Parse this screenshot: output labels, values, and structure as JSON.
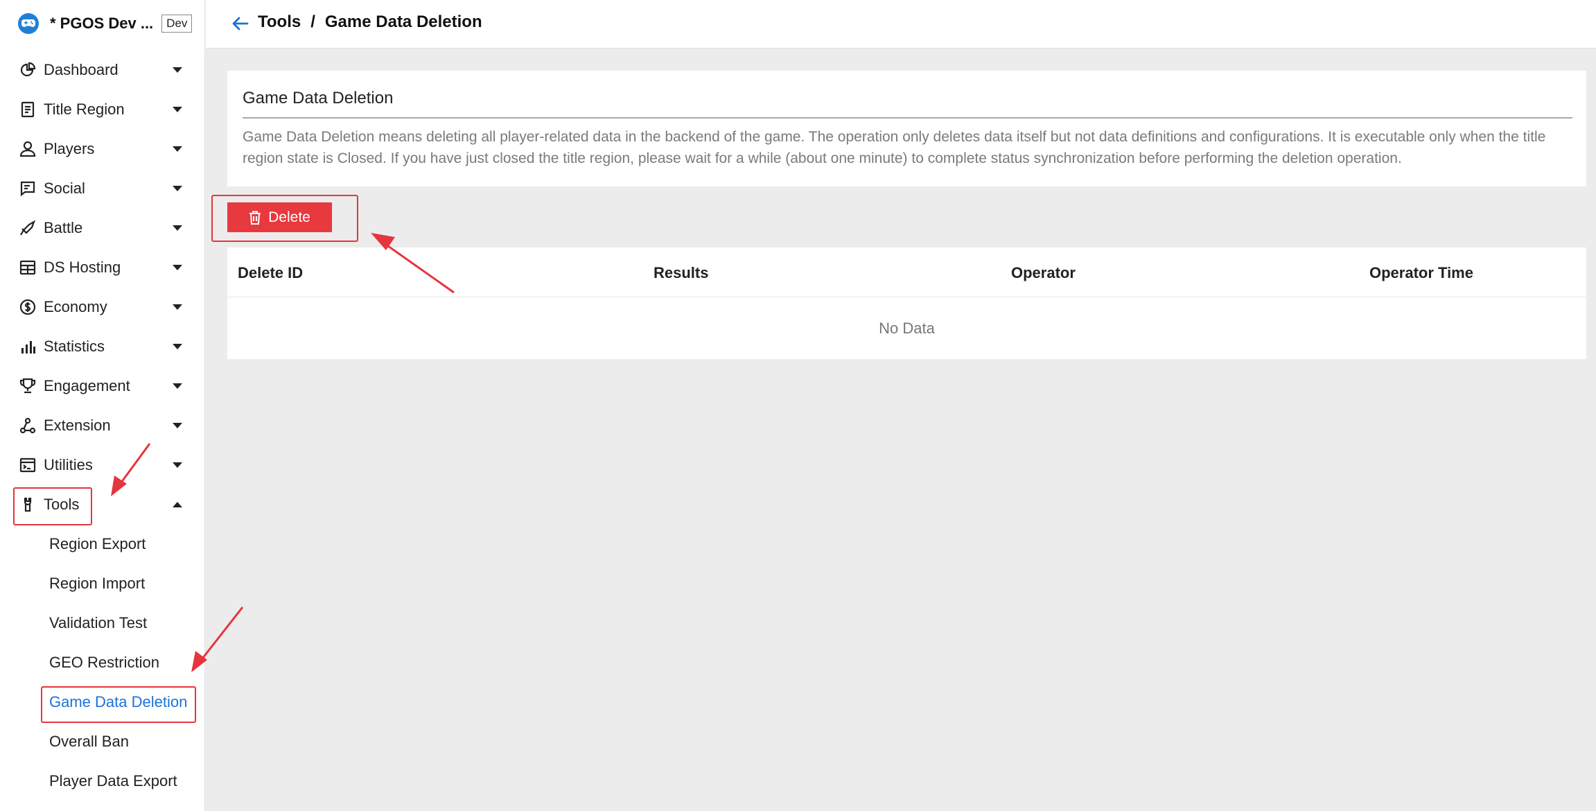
{
  "sidebar": {
    "brand_name": "* PGOS Dev ...",
    "env_badge": "Dev",
    "items": [
      {
        "label": "Dashboard",
        "icon": "pie-chart-icon"
      },
      {
        "label": "Title Region",
        "icon": "document-icon"
      },
      {
        "label": "Players",
        "icon": "user-icon"
      },
      {
        "label": "Social",
        "icon": "chat-icon"
      },
      {
        "label": "Battle",
        "icon": "sword-icon"
      },
      {
        "label": "DS Hosting",
        "icon": "server-icon"
      },
      {
        "label": "Economy",
        "icon": "dollar-icon"
      },
      {
        "label": "Statistics",
        "icon": "bar-chart-icon"
      },
      {
        "label": "Engagement",
        "icon": "trophy-icon"
      },
      {
        "label": "Extension",
        "icon": "network-icon"
      },
      {
        "label": "Utilities",
        "icon": "terminal-icon"
      },
      {
        "label": "Tools",
        "icon": "wrench-icon",
        "expanded": true
      }
    ],
    "tools_sub": [
      {
        "label": "Region Export"
      },
      {
        "label": "Region Import"
      },
      {
        "label": "Validation Test"
      },
      {
        "label": "GEO Restriction"
      },
      {
        "label": "Game Data Deletion",
        "active": true
      },
      {
        "label": "Overall Ban"
      },
      {
        "label": "Player Data Export"
      }
    ]
  },
  "header": {
    "breadcrumb_parent": "Tools",
    "breadcrumb_sep": "/",
    "breadcrumb_current": "Game Data Deletion"
  },
  "main": {
    "card_title": "Game Data Deletion",
    "card_description": "Game Data Deletion means deleting all player-related data in the backend of the game. The operation only deletes data itself but not data definitions and configurations. It is executable only when the title region state is Closed. If you have just closed the title region, please wait for a while (about one minute) to complete status synchronization before performing the deletion operation.",
    "delete_label": "Delete",
    "table": {
      "columns": [
        "Delete ID",
        "Results",
        "Operator",
        "Operator Time"
      ],
      "empty_text": "No Data"
    }
  },
  "colors": {
    "accent": "#1a73d9",
    "danger": "#e8393f",
    "annotation": "#e5353d",
    "background": "#ececec"
  }
}
